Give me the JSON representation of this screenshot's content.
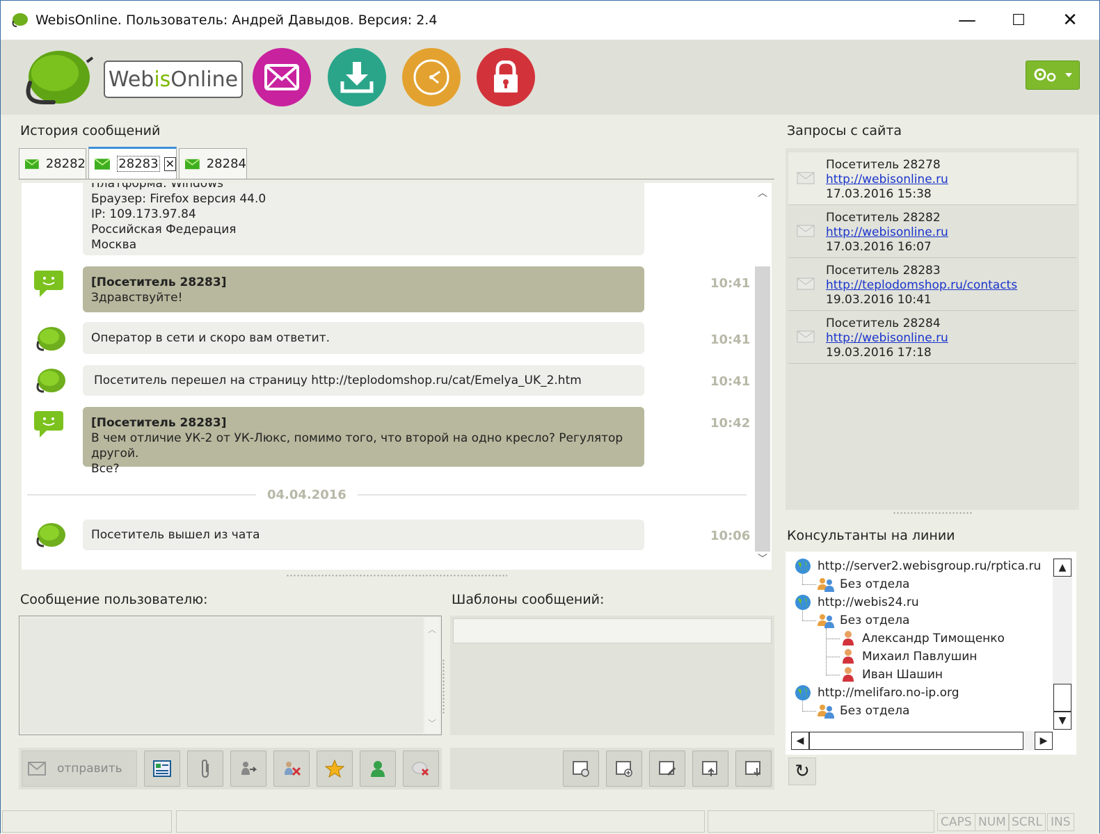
{
  "window": {
    "title": "WebisOnline. Пользователь: Андрей Давыдов. Версия: 2.4",
    "minimize": "—",
    "maximize": "☐",
    "close": "✕"
  },
  "toolbar": {
    "logo_web": "Web",
    "logo_is": "is",
    "logo_online": "Online",
    "buttons": [
      "envelope-icon",
      "download-icon",
      "clock-icon",
      "lock-icon"
    ],
    "colors": {
      "mail": "#c8229f",
      "download": "#2aa58a",
      "clock": "#e3a230",
      "lock": "#d2333b",
      "settings": "#7fba2c"
    }
  },
  "history": {
    "label": "История сообщений",
    "tabs": [
      {
        "label": "28282"
      },
      {
        "label": "28283",
        "active": true
      },
      {
        "label": "28284"
      }
    ]
  },
  "chat": {
    "info_lines": [
      "Платформа: Windows",
      "Браузер: Firefox версия 44.0",
      "IP: 109.173.97.84",
      "Российская Федерация",
      "Москва"
    ],
    "messages": [
      {
        "author": "[Посетитель 28283]",
        "text": "Здравствуйте!",
        "time": "10:41"
      },
      {
        "text": "Оператор в сети и скоро вам ответит.",
        "time": "10:41"
      },
      {
        "text": "Посетитель перешел на страницу http://teplodomshop.ru/cat/Emelya_UK_2.htm",
        "time": "10:41"
      },
      {
        "author": "[Посетитель 28283]",
        "text": "В чем отличие УК-2 от УК-Люкс, помимо того, что второй на одно кресло? Регулятор другой.",
        "text2": "Все?",
        "time": "10:42"
      },
      {
        "text": "Посетитель вышел из чата",
        "time": "10:06"
      }
    ],
    "date_separator": "04.04.2016"
  },
  "compose": {
    "label": "Сообщение пользователю:",
    "value": "",
    "send_label": "отправить"
  },
  "templates": {
    "label": "Шаблоны сообщений:",
    "value": ""
  },
  "requests": {
    "label": "Запросы с сайта",
    "items": [
      {
        "visitor": "Посетитель 28278",
        "url": "http://webisonline.ru",
        "time": "17.03.2016 15:38"
      },
      {
        "visitor": "Посетитель 28282",
        "url": "http://webisonline.ru",
        "time": "17.03.2016 16:07"
      },
      {
        "visitor": "Посетитель 28283",
        "url": "http://teplodomshop.ru/contacts",
        "time": "19.03.2016 10:41"
      },
      {
        "visitor": "Посетитель 28284",
        "url": "http://webisonline.ru",
        "time": "19.03.2016 17:18"
      }
    ]
  },
  "consultants": {
    "label": "Консультанты на линии",
    "tree": [
      {
        "kind": "site",
        "text": "http://server2.webisgroup.ru/rptica.ru"
      },
      {
        "kind": "group",
        "text": "Без отдела"
      },
      {
        "kind": "site",
        "text": "http://webis24.ru"
      },
      {
        "kind": "group",
        "text": "Без отдела"
      },
      {
        "kind": "person",
        "text": "Александр Тимощенко"
      },
      {
        "kind": "person",
        "text": "Михаил Павлушин"
      },
      {
        "kind": "person",
        "text": "Иван Шашин"
      },
      {
        "kind": "site",
        "text": "http://melifaro.no-ip.org"
      },
      {
        "kind": "group",
        "text": "Без отдела"
      }
    ]
  },
  "statusbar": {
    "keys": [
      "CAPS",
      "NUM",
      "SCRL",
      "INS"
    ]
  }
}
